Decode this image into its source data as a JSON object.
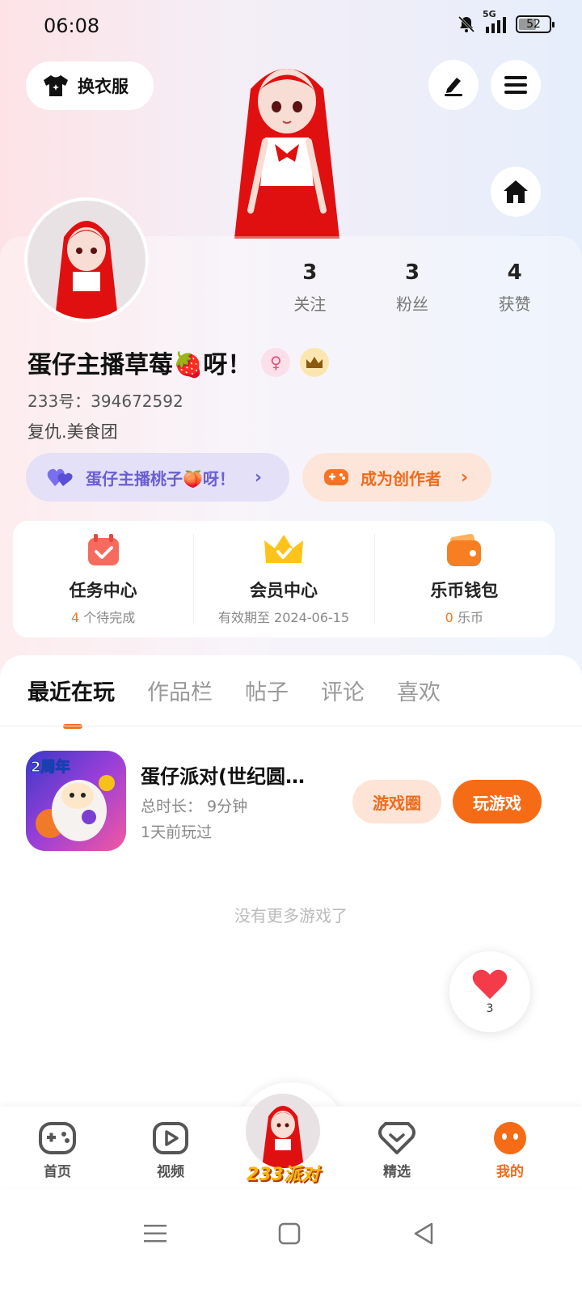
{
  "status_bar": {
    "time": "06:08",
    "network": "5G",
    "battery": "52"
  },
  "top": {
    "outfit_label": "换衣服"
  },
  "profile": {
    "stats": [
      {
        "num": "3",
        "label": "关注"
      },
      {
        "num": "3",
        "label": "粉丝"
      },
      {
        "num": "4",
        "label": "获赞"
      }
    ],
    "nickname": "蛋仔主播草莓🍓呀！",
    "gender_badge": "♀",
    "uid": "233号：394672592",
    "bio": "复仇.美食团"
  },
  "pills": {
    "fan_group": "蛋仔主播桃子🍑呀！",
    "creator": "成为创作者",
    "chevron": "›"
  },
  "quick": [
    {
      "title": "任务中心",
      "highlight": "4",
      "sub": " 个待完成"
    },
    {
      "title": "会员中心",
      "highlight": "",
      "sub": "有效期至 2024-06-15"
    },
    {
      "title": "乐币钱包",
      "highlight": "0",
      "sub": " 乐币"
    }
  ],
  "tabs": [
    "最近在玩",
    "作品栏",
    "帖子",
    "评论",
    "喜欢"
  ],
  "game": {
    "name": "蛋仔派对(世纪圆…",
    "duration": "总时长： 9分钟",
    "last_played": "1天前玩过",
    "circle_btn": "游戏圈",
    "play_btn": "玩游戏",
    "icon_badge": "2周年"
  },
  "no_more": "没有更多游戏了",
  "like_float": {
    "count": "3"
  },
  "bottom_nav": {
    "home": "首页",
    "video": "视频",
    "center": "233派对",
    "featured": "精选",
    "mine": "我的"
  },
  "colors": {
    "accent": "#f66b16",
    "purple": "#6a5fd0"
  }
}
